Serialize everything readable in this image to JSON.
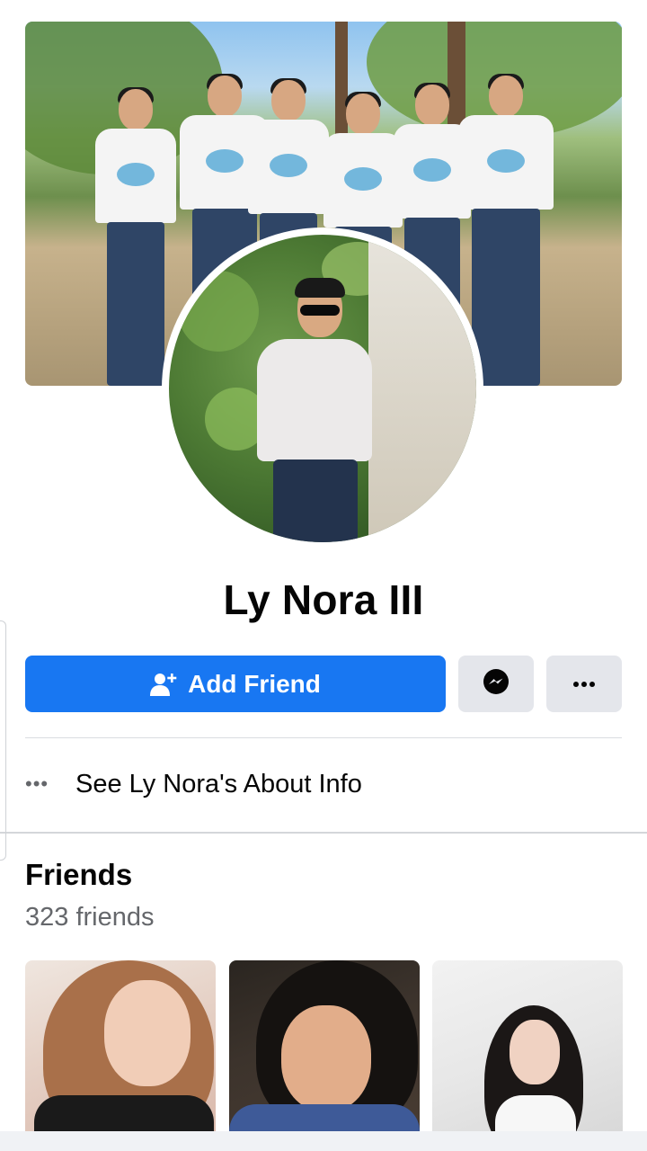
{
  "profile": {
    "name": "Ly Nora III"
  },
  "actions": {
    "add_friend_label": "Add Friend",
    "message_icon": "messenger-icon",
    "more_icon": "more-dots-icon",
    "more_label": "•••"
  },
  "about": {
    "label": "See Ly Nora's About Info",
    "icon": "more-dots-icon",
    "dots": "•••"
  },
  "friends": {
    "title": "Friends",
    "count_text": "323 friends",
    "thumbnails": [
      {
        "icon": "friend-photo"
      },
      {
        "icon": "friend-photo"
      },
      {
        "icon": "friend-photo"
      }
    ]
  },
  "colors": {
    "primary_blue": "#1877f2",
    "button_grey": "#e4e6eb",
    "secondary_text": "#65676b",
    "divider": "#dadde1"
  }
}
